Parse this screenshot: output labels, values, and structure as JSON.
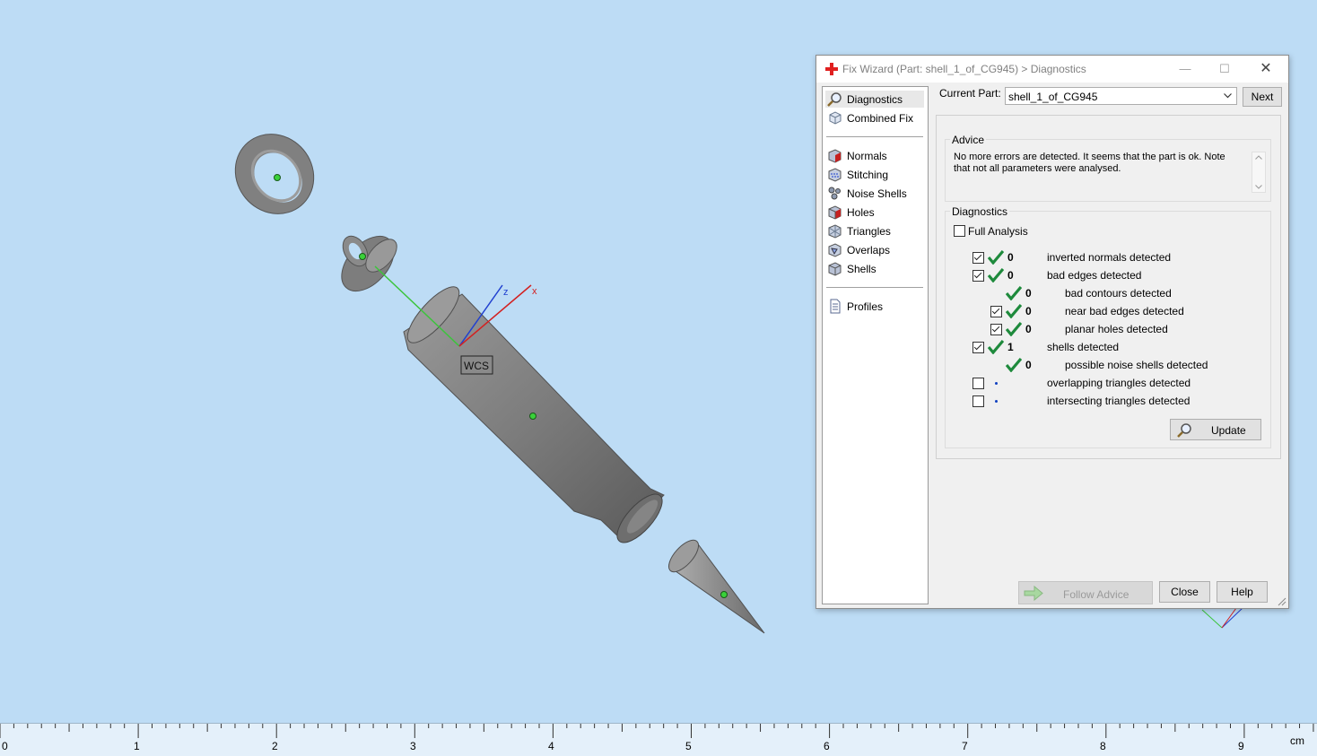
{
  "viewport": {
    "wcs_label": "WCS",
    "axis_z": "z",
    "axis_x": "x"
  },
  "ruler": {
    "ticks": [
      "0",
      "1",
      "2",
      "3",
      "4",
      "5",
      "6",
      "7",
      "8",
      "9"
    ],
    "unit": "cm"
  },
  "dialog": {
    "title": "Fix Wizard (Part: shell_1_of_CG945) > Diagnostics",
    "nav": {
      "top_items": [
        {
          "label": "Diagnostics",
          "icon": "magnifier-icon"
        },
        {
          "label": "Combined Fix",
          "icon": "cube-icon"
        }
      ],
      "fix_items": [
        {
          "label": "Normals",
          "icon": "normals-icon"
        },
        {
          "label": "Stitching",
          "icon": "stitching-icon"
        },
        {
          "label": "Noise Shells",
          "icon": "noise-shells-icon"
        },
        {
          "label": "Holes",
          "icon": "holes-icon"
        },
        {
          "label": "Triangles",
          "icon": "triangles-icon"
        },
        {
          "label": "Overlaps",
          "icon": "overlaps-icon"
        },
        {
          "label": "Shells",
          "icon": "shells-icon"
        }
      ],
      "bottom_items": [
        {
          "label": "Profiles",
          "icon": "document-icon"
        }
      ]
    },
    "current_part_label": "Current Part:",
    "current_part_value": "shell_1_of_CG945",
    "next_label": "Next",
    "advice": {
      "title": "Advice",
      "text": "No more errors are detected. It seems that the part is ok. Note that not all parameters were analysed."
    },
    "diagnostics": {
      "title": "Diagnostics",
      "full_analysis_label": "Full Analysis",
      "rows": [
        {
          "checkbox": true,
          "checked": true,
          "status": "ok",
          "count": "0",
          "label": "inverted normals detected",
          "indent": 0
        },
        {
          "checkbox": true,
          "checked": true,
          "status": "ok",
          "count": "0",
          "label": "bad edges detected",
          "indent": 0
        },
        {
          "checkbox": false,
          "checked": false,
          "status": "ok",
          "count": "0",
          "label": "bad contours detected",
          "indent": 1
        },
        {
          "checkbox": true,
          "checked": true,
          "status": "ok",
          "count": "0",
          "label": "near bad edges detected",
          "indent": 1
        },
        {
          "checkbox": true,
          "checked": true,
          "status": "ok",
          "count": "0",
          "label": "planar holes detected",
          "indent": 1
        },
        {
          "checkbox": true,
          "checked": true,
          "status": "ok",
          "count": "1",
          "label": "shells detected",
          "indent": 0
        },
        {
          "checkbox": false,
          "checked": false,
          "status": "ok",
          "count": "0",
          "label": "possible noise shells detected",
          "indent": 1
        },
        {
          "checkbox": true,
          "checked": false,
          "status": "unknown",
          "count": "",
          "label": "overlapping triangles detected",
          "indent": 0
        },
        {
          "checkbox": true,
          "checked": false,
          "status": "unknown",
          "count": "",
          "label": "intersecting triangles detected",
          "indent": 0
        }
      ],
      "update_label": "Update"
    },
    "follow_advice_label": "Follow Advice",
    "close_label": "Close",
    "help_label": "Help"
  },
  "colors": {
    "viewport_bg": "#bddcf5",
    "check_green": "#1e8a3c",
    "axis_x": "#d32020",
    "axis_y": "#3cc43c",
    "axis_z": "#2040d0"
  }
}
